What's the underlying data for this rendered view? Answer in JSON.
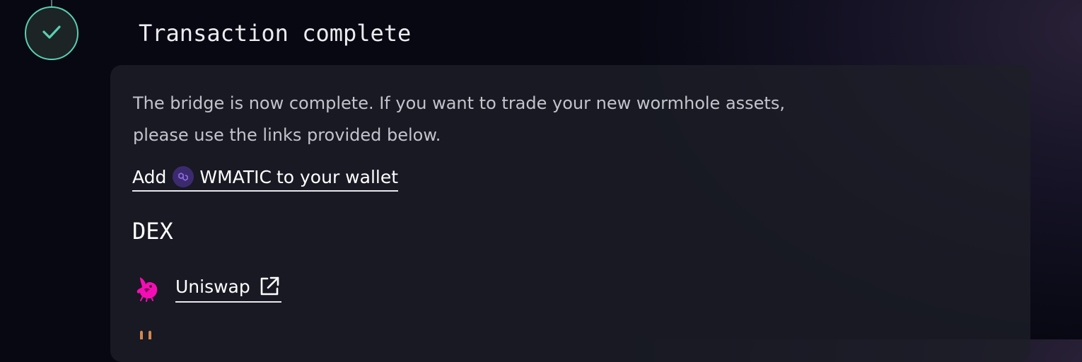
{
  "step": {
    "title": "Transaction complete",
    "status_icon": "check-icon",
    "accent_color": "#5ad0b2"
  },
  "card": {
    "description": "The bridge is now complete. If you want to trade your new wormhole assets, please use the links provided below.",
    "add_token": {
      "prefix": "Add",
      "token": "WMATIC",
      "suffix": "to your wallet",
      "icon": "polygon-icon"
    },
    "dex_heading": "DEX",
    "dexes": [
      {
        "name": "Uniswap",
        "icon": "uniswap-icon",
        "link_icon": "external-link-icon"
      },
      {
        "name": "",
        "icon": "dex-logo-icon"
      }
    ]
  }
}
